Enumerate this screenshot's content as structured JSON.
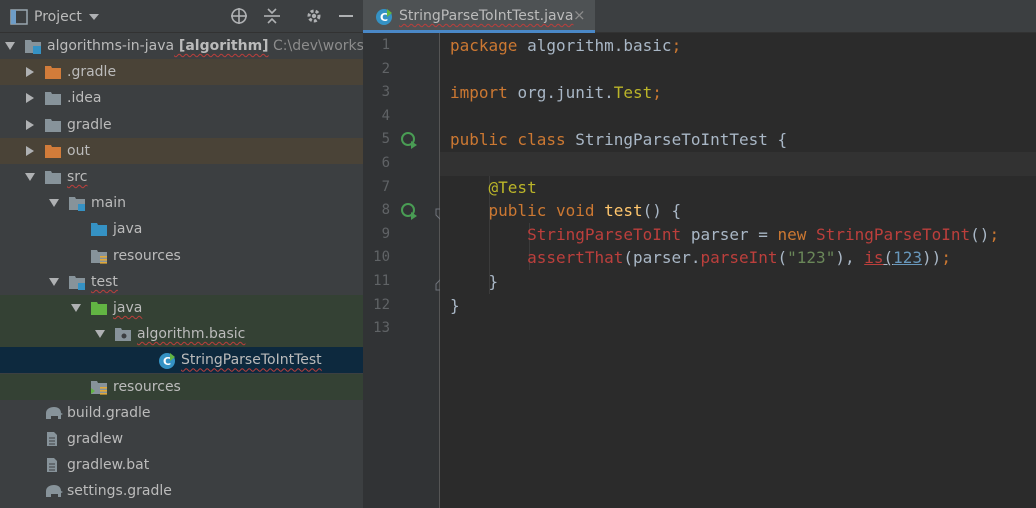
{
  "project_panel": {
    "title": "Project",
    "tree": [
      {
        "label": "algorithms-in-java",
        "module": "[algorithm]",
        "path": "C:\\dev\\works",
        "indent": 0,
        "arrow": "down",
        "icon": "module-folder",
        "style": ""
      },
      {
        "label": ".gradle",
        "indent": 1,
        "arrow": "right",
        "icon": "folder-excluded",
        "style": "row-excluded"
      },
      {
        "label": ".idea",
        "indent": 1,
        "arrow": "right",
        "icon": "folder",
        "style": ""
      },
      {
        "label": "gradle",
        "indent": 1,
        "arrow": "right",
        "icon": "folder",
        "style": ""
      },
      {
        "label": "out",
        "indent": 1,
        "arrow": "right",
        "icon": "folder-excluded",
        "style": "row-excluded"
      },
      {
        "label": "src",
        "indent": 1,
        "arrow": "down",
        "icon": "folder",
        "style": "",
        "squiggle": true
      },
      {
        "label": "main",
        "indent": 2,
        "arrow": "down",
        "icon": "folder-module",
        "style": ""
      },
      {
        "label": "java",
        "indent": 3,
        "arrow": "",
        "icon": "folder-source",
        "style": ""
      },
      {
        "label": "resources",
        "indent": 3,
        "arrow": "",
        "icon": "folder-resources",
        "style": ""
      },
      {
        "label": "test",
        "indent": 2,
        "arrow": "down",
        "icon": "folder-module",
        "style": "",
        "squiggle": true
      },
      {
        "label": "java",
        "indent": 3,
        "arrow": "down",
        "icon": "folder-test",
        "style": "row-test",
        "squiggle": true
      },
      {
        "label": "algorithm.basic",
        "indent": 4,
        "arrow": "down",
        "icon": "package",
        "style": "row-test",
        "squiggle": true
      },
      {
        "label": "StringParseToIntTest",
        "indent": 5,
        "arrow": "",
        "icon": "class-test",
        "style": "row-selected",
        "squiggle": true
      },
      {
        "label": "resources",
        "indent": 3,
        "arrow": "",
        "icon": "folder-test-resources",
        "style": "row-test"
      },
      {
        "label": "build.gradle",
        "indent": 1,
        "arrow": "",
        "icon": "gradle-elephant",
        "style": ""
      },
      {
        "label": "gradlew",
        "indent": 1,
        "arrow": "",
        "icon": "file",
        "style": ""
      },
      {
        "label": "gradlew.bat",
        "indent": 1,
        "arrow": "",
        "icon": "file",
        "style": ""
      },
      {
        "label": "settings.gradle",
        "indent": 1,
        "arrow": "",
        "icon": "gradle-elephant",
        "style": ""
      }
    ]
  },
  "editor": {
    "tab_label": "StringParseToIntTest.java",
    "tab_close": "×",
    "current_line": 6,
    "line_numbers": [
      "1",
      "2",
      "3",
      "4",
      "5",
      "6",
      "7",
      "8",
      "9",
      "10",
      "11",
      "12",
      "13"
    ],
    "lines": [
      [
        {
          "t": "package ",
          "c": "kw"
        },
        {
          "t": "algorithm.basic",
          "c": ""
        },
        {
          "t": ";",
          "c": "kw"
        }
      ],
      [],
      [
        {
          "t": "import ",
          "c": "kw"
        },
        {
          "t": "org.junit.",
          "c": ""
        },
        {
          "t": "Test",
          "c": "ann"
        },
        {
          "t": ";",
          "c": "kw"
        }
      ],
      [],
      [
        {
          "t": "public class ",
          "c": "kw"
        },
        {
          "t": "StringParseToIntTest ",
          "c": ""
        },
        {
          "t": "{",
          "c": ""
        }
      ],
      [],
      [
        {
          "t": "    ",
          "c": ""
        },
        {
          "t": "@Test",
          "c": "ann"
        }
      ],
      [
        {
          "t": "    ",
          "c": ""
        },
        {
          "t": "public void ",
          "c": "kw"
        },
        {
          "t": "test",
          "c": "fn"
        },
        {
          "t": "() {",
          "c": ""
        }
      ],
      [
        {
          "t": "        ",
          "c": ""
        },
        {
          "t": "StringParseToInt",
          "c": "err"
        },
        {
          "t": " parser = ",
          "c": ""
        },
        {
          "t": "new ",
          "c": "kw"
        },
        {
          "t": "StringParseToInt",
          "c": "err"
        },
        {
          "t": "()",
          "c": ""
        },
        {
          "t": ";",
          "c": "kw"
        }
      ],
      [
        {
          "t": "        ",
          "c": ""
        },
        {
          "t": "assertThat",
          "c": "err"
        },
        {
          "t": "(parser.",
          "c": ""
        },
        {
          "t": "parseInt",
          "c": "err"
        },
        {
          "t": "(",
          "c": ""
        },
        {
          "t": "\"123\"",
          "c": "str"
        },
        {
          "t": "), ",
          "c": ""
        },
        {
          "t": "is",
          "c": "err ul"
        },
        {
          "t": "(",
          "c": "ul"
        },
        {
          "t": "123",
          "c": "num ul"
        },
        {
          "t": "))",
          "c": ""
        },
        {
          "t": ";",
          "c": "kw"
        }
      ],
      [
        {
          "t": "    }",
          "c": ""
        }
      ],
      [
        {
          "t": "}",
          "c": ""
        }
      ],
      []
    ],
    "run_icon_lines": [
      5,
      8
    ],
    "fold_icon_lines": [
      8,
      11
    ]
  },
  "colors": {
    "panel_bg": "#3c3f41",
    "editor_bg": "#2b2b2b",
    "selection": "#0d293e",
    "tab_underline": "#4a88c7"
  }
}
